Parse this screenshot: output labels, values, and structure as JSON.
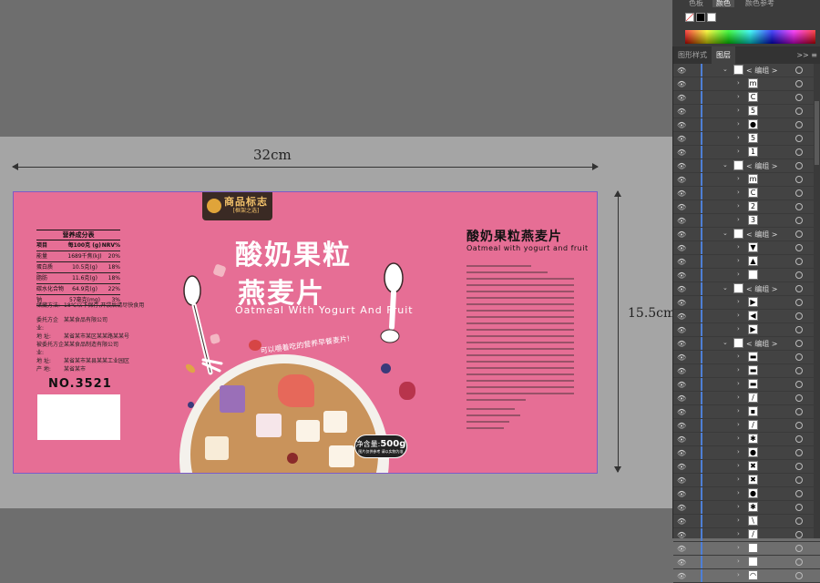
{
  "panel_tabs": [
    "色板",
    "颜色",
    "颜色参考"
  ],
  "layers_panel": {
    "tabs": [
      "图形样式",
      "图层"
    ],
    "menu_glyphs": ">>  ≡",
    "rows": [
      {
        "name": "< 编组 >",
        "thumb": "",
        "group": true
      },
      {
        "name": "",
        "thumb": "m"
      },
      {
        "name": "",
        "thumb": "C"
      },
      {
        "name": "",
        "thumb": "5"
      },
      {
        "name": "",
        "thumb": "●"
      },
      {
        "name": "",
        "thumb": "5"
      },
      {
        "name": "",
        "thumb": "1"
      },
      {
        "name": "< 编组 >",
        "thumb": "",
        "group": true
      },
      {
        "name": "",
        "thumb": "m"
      },
      {
        "name": "",
        "thumb": "C"
      },
      {
        "name": "",
        "thumb": "2"
      },
      {
        "name": "",
        "thumb": "3"
      },
      {
        "name": "< 编组 >",
        "thumb": "",
        "group": true
      },
      {
        "name": "",
        "thumb": "▼"
      },
      {
        "name": "",
        "thumb": "▲"
      },
      {
        "name": "",
        "thumb": ""
      },
      {
        "name": "< 编组 >",
        "thumb": "",
        "group": true
      },
      {
        "name": "",
        "thumb": "▶"
      },
      {
        "name": "",
        "thumb": "◀"
      },
      {
        "name": "",
        "thumb": "▶"
      },
      {
        "name": "< 编组 >",
        "thumb": "",
        "group": true
      },
      {
        "name": "",
        "thumb": "▬"
      },
      {
        "name": "",
        "thumb": "▬"
      },
      {
        "name": "",
        "thumb": "▬"
      },
      {
        "name": "",
        "thumb": "/"
      },
      {
        "name": "",
        "thumb": "▪"
      },
      {
        "name": "",
        "thumb": "/"
      },
      {
        "name": "",
        "thumb": "✱"
      },
      {
        "name": "",
        "thumb": "●"
      },
      {
        "name": "",
        "thumb": "✖"
      },
      {
        "name": "",
        "thumb": "✖"
      },
      {
        "name": "",
        "thumb": "●"
      },
      {
        "name": "",
        "thumb": "✱"
      },
      {
        "name": "",
        "thumb": "\\"
      },
      {
        "name": "",
        "thumb": "/"
      },
      {
        "name": "",
        "thumb": ""
      },
      {
        "name": "",
        "thumb": ""
      },
      {
        "name": "",
        "thumb": "◠"
      }
    ]
  },
  "dimensions": {
    "width": "32cm",
    "height": "15.5cm"
  },
  "package": {
    "badge_line1": "商品标志",
    "badge_line2": "[框架之选]",
    "nutrition": {
      "title": "营养成分表",
      "header": [
        "项目",
        "每100克 (g)",
        "NRV%"
      ],
      "rows": [
        [
          "能量",
          "1689千焦(kJ)",
          "20%"
        ],
        [
          "蛋白质",
          "10.5克(g)",
          "18%"
        ],
        [
          "脂肪",
          "11.6克(g)",
          "18%"
        ],
        [
          "碳水化合物",
          "64.9克(g)",
          "22%"
        ],
        [
          "钠",
          "57毫克(mg)",
          "3%"
        ]
      ]
    },
    "specs": [
      {
        "k": "储藏方法:",
        "v": "18℃以下保存,开袋后请尽快食用"
      },
      {
        "k": "委托方企业:",
        "v": "某某食品有限公司"
      },
      {
        "k": "地    址:",
        "v": "某省某市某区某某路某某号"
      },
      {
        "k": "被委托方企业:",
        "v": "某某食品制造有限公司"
      },
      {
        "k": "地    址:",
        "v": "某省某市某县某某工业园区"
      },
      {
        "k": "产    地:",
        "v": "某省某市"
      }
    ],
    "number": "NO.3521",
    "title_line1": "酸奶果粒",
    "title_line2": "燕麦片",
    "subtitle_en": "Oatmeal With Yogurt And Fruit",
    "slogan": "可以嚼着吃的营养早餐麦片!",
    "net_weight_label": "净含量:",
    "net_weight_value": "500g",
    "net_weight_note": "图片仅供参考 请以实物为准",
    "right_title": "酸奶果粒燕麦片",
    "right_subtitle": "Oatmeal with yogurt and fruit"
  },
  "colors": {
    "package_pink": "#e66e95",
    "panel_bg": "#434343",
    "canvas_gray": "#a5a5a5"
  }
}
